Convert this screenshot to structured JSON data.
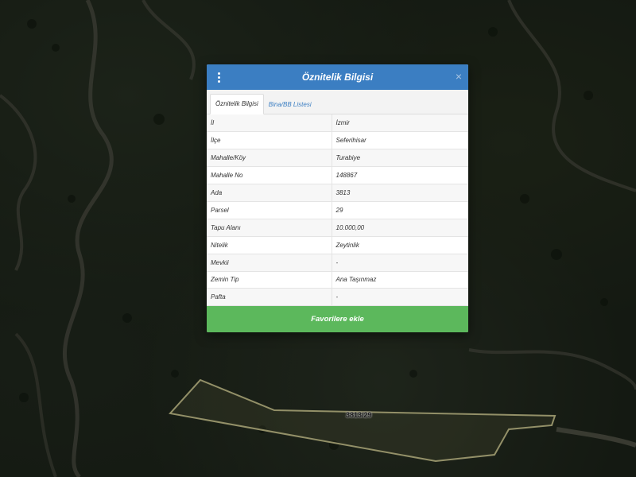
{
  "modal": {
    "title": "Öznitelik Bilgisi",
    "close_glyph": "×",
    "menu_icon": "vertical-dots-icon",
    "tabs": [
      {
        "label": "Öznitelik Bilgisi",
        "active": true
      },
      {
        "label": "Bina/BB Listesi",
        "active": false
      }
    ],
    "rows": [
      {
        "key": "İl",
        "value": "İzmir"
      },
      {
        "key": "İlçe",
        "value": "Seferihisar"
      },
      {
        "key": "Mahalle/Köy",
        "value": "Turabiye"
      },
      {
        "key": "Mahalle No",
        "value": "148867"
      },
      {
        "key": "Ada",
        "value": "3813"
      },
      {
        "key": "Parsel",
        "value": "29"
      },
      {
        "key": "Tapu Alanı",
        "value": "10.000,00"
      },
      {
        "key": "Nitelik",
        "value": "Zeytinlik"
      },
      {
        "key": "Mevkii",
        "value": "-"
      },
      {
        "key": "Zemin Tip",
        "value": "Ana Taşınmaz"
      },
      {
        "key": "Pafta",
        "value": "-"
      }
    ],
    "favorite_button": "Favorilere ekle"
  },
  "map": {
    "parcel_label": "3813/29",
    "parcel_outline_color": "#d9d49a"
  },
  "colors": {
    "header": "#3b7ec2",
    "favorite": "#5cb85c"
  }
}
